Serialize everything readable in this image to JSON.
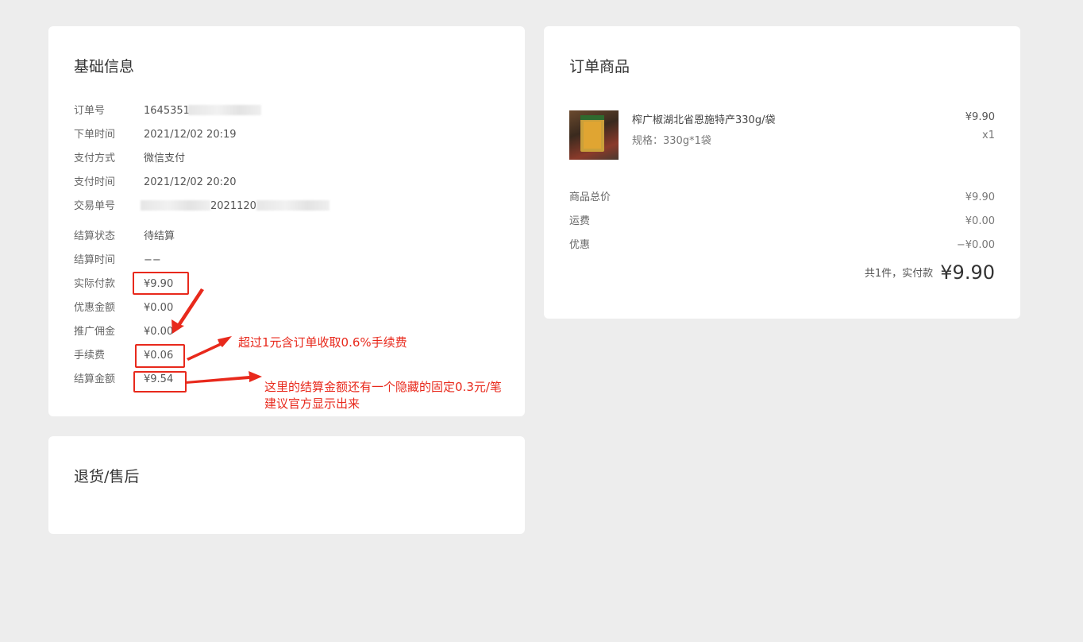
{
  "basic": {
    "title": "基础信息",
    "fields": {
      "order_no": {
        "label": "订单号",
        "value": "1645351"
      },
      "order_time": {
        "label": "下单时间",
        "value": "2021/12/02 20:19"
      },
      "pay_method": {
        "label": "支付方式",
        "value": "微信支付"
      },
      "pay_time": {
        "label": "支付时间",
        "value": "2021/12/02 20:20"
      },
      "trade_no": {
        "label": "交易单号",
        "value": "2021120"
      },
      "settle_status": {
        "label": "结算状态",
        "value": "待结算"
      },
      "settle_time": {
        "label": "结算时间",
        "value": "−−"
      },
      "actual_pay": {
        "label": "实际付款",
        "value": "¥9.90"
      },
      "discount": {
        "label": "优惠金额",
        "value": "¥0.00"
      },
      "commission": {
        "label": "推广佣金",
        "value": "¥0.00"
      },
      "fee": {
        "label": "手续费",
        "value": "¥0.06"
      },
      "settle_amount": {
        "label": "结算金额",
        "value": "¥9.54"
      }
    }
  },
  "annotations": {
    "fee_note": "超过1元含订单收取0.6%手续费",
    "settle_note_line1": "这里的结算金额还有一个隐藏的固定0.3元/笔",
    "settle_note_line2": "建议官方显示出来",
    "color": "#e8291c"
  },
  "returns": {
    "title": "退货/售后"
  },
  "goods": {
    "title": "订单商品",
    "item": {
      "name": "榨广椒湖北省恩施特产330g/袋",
      "spec": "规格：330g*1袋",
      "price": "¥9.90",
      "qty": "x1",
      "image_icon": "product-thumbnail"
    },
    "summary": {
      "subtotal": {
        "label": "商品总价",
        "value": "¥9.90"
      },
      "shipping": {
        "label": "运费",
        "value": "¥0.00"
      },
      "discount": {
        "label": "优惠",
        "value": "−¥0.00"
      }
    },
    "total_text": "共1件，实付款",
    "total_amount": "¥9.90"
  }
}
